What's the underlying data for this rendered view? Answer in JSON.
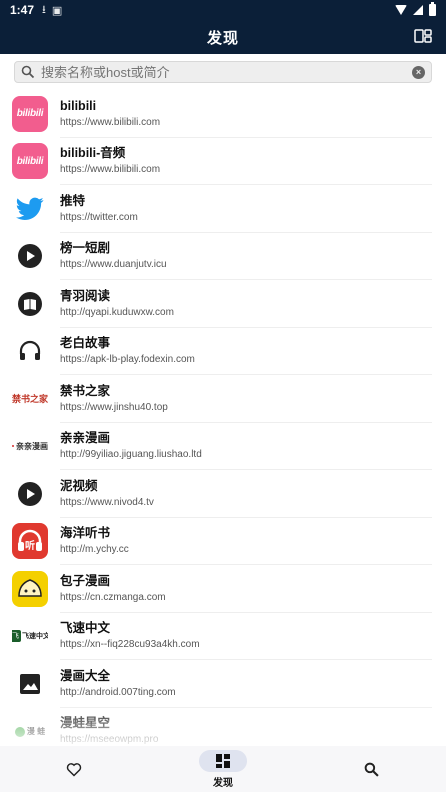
{
  "status": {
    "time": "1:47"
  },
  "appbar": {
    "title": "发现"
  },
  "search": {
    "placeholder": "搜索名称或host或简介"
  },
  "sources": [
    {
      "name": "bilibili",
      "url": "https://www.bilibili.com",
      "icon": "bilibili-logo",
      "logo_text": "bilibili"
    },
    {
      "name": "bilibili-音频",
      "url": "https://www.bilibili.com",
      "icon": "bilibili-logo",
      "logo_text": "bilibili"
    },
    {
      "name": "推特",
      "url": "https://twitter.com",
      "icon": "twitter-bird-icon"
    },
    {
      "name": "榜一短剧",
      "url": "https://www.duanjutv.icu",
      "icon": "play-circle-icon"
    },
    {
      "name": "青羽阅读",
      "url": "http://qyapi.kuduwxw.com",
      "icon": "book-circle-icon"
    },
    {
      "name": "老白故事",
      "url": "https://apk-lb-play.fodexin.com",
      "icon": "headphones-icon"
    },
    {
      "name": "禁书之家",
      "url": "https://www.jinshu40.top",
      "icon": "jinshu-logo",
      "logo_text": "禁书之家"
    },
    {
      "name": "亲亲漫画",
      "url": "http://99yiliao.jiguang.liushao.ltd",
      "icon": "qinqin-logo",
      "logo_text": "亲亲漫画"
    },
    {
      "name": "泥视频",
      "url": "https://www.nivod4.tv",
      "icon": "play-circle-icon"
    },
    {
      "name": "海洋听书",
      "url": "http://m.ychy.cc",
      "icon": "haiyang-headphones-logo",
      "logo_text": "听"
    },
    {
      "name": "包子漫画",
      "url": "https://cn.czmanga.com",
      "icon": "baozi-logo"
    },
    {
      "name": "飞速中文",
      "url": "https://xn--fiq228cu93a4kh.com",
      "icon": "feisu-logo",
      "logo_text": "飞速中文"
    },
    {
      "name": "漫画大全",
      "url": "http://android.007ting.com",
      "icon": "image-icon"
    },
    {
      "name": "漫蛙星空",
      "url": "https://mseeowpm.pro",
      "icon": "manwa-logo",
      "logo_text": "漫 蛙"
    }
  ],
  "bottom_nav": [
    {
      "label": "",
      "icon": "heart-outline-icon",
      "active": false
    },
    {
      "label": "发现",
      "icon": "dashboard-icon",
      "active": true
    },
    {
      "label": "",
      "icon": "search-icon",
      "active": false
    }
  ],
  "colors": {
    "appbar": "#0b1f38",
    "bilibili": "#f25d8e",
    "twitter": "#1d9bf0",
    "active_pill": "#dfe3ef"
  }
}
